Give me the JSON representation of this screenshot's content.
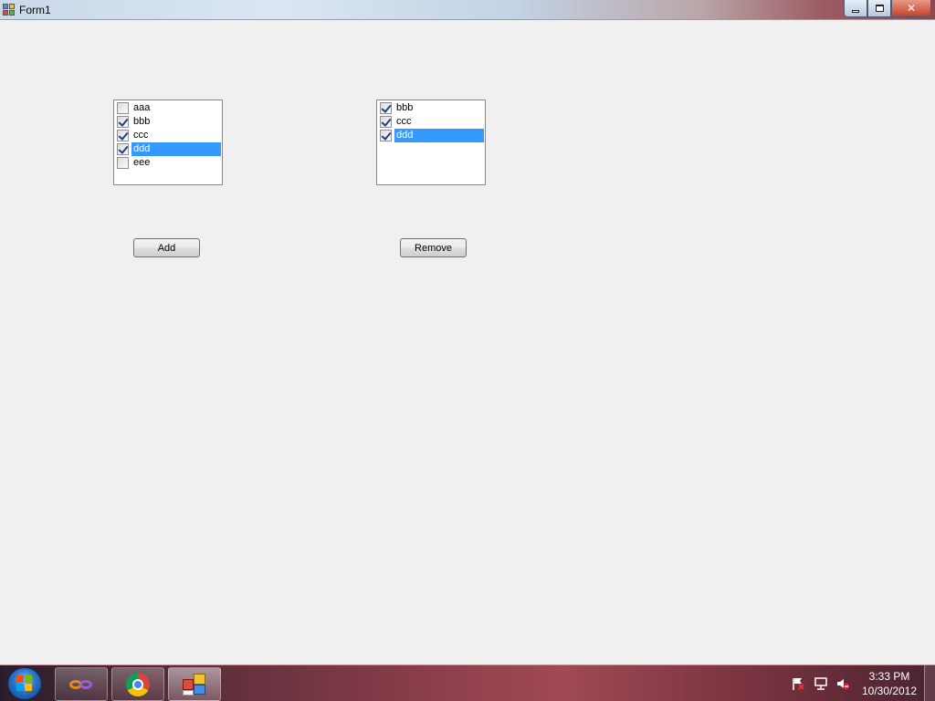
{
  "window": {
    "title": "Form1",
    "controls": {
      "minimize": "minimize",
      "restore": "restore",
      "close": "✕"
    }
  },
  "left_list": {
    "items": [
      {
        "label": "aaa",
        "checked": false,
        "selected": false
      },
      {
        "label": "bbb",
        "checked": true,
        "selected": false
      },
      {
        "label": "ccc",
        "checked": true,
        "selected": false
      },
      {
        "label": "ddd",
        "checked": true,
        "selected": true
      },
      {
        "label": "eee",
        "checked": false,
        "selected": false
      }
    ]
  },
  "right_list": {
    "items": [
      {
        "label": "bbb",
        "checked": true,
        "selected": false
      },
      {
        "label": "ccc",
        "checked": true,
        "selected": false
      },
      {
        "label": "ddd",
        "checked": true,
        "selected": true
      }
    ]
  },
  "buttons": {
    "add": "Add",
    "remove": "Remove"
  },
  "taskbar": {
    "pinned": [
      {
        "name": "visual-studio",
        "icon": "visual-studio-icon"
      },
      {
        "name": "chrome",
        "icon": "chrome-icon"
      },
      {
        "name": "form1",
        "icon": "winforms-app-icon",
        "active": true
      }
    ],
    "tray_icons": [
      "action-center-flag-icon",
      "network-icon",
      "volume-muted-icon"
    ],
    "time": "3:33 PM",
    "date": "10/30/2012"
  },
  "colors": {
    "selection": "#3399ff",
    "client_bg": "#f0f0f0"
  }
}
